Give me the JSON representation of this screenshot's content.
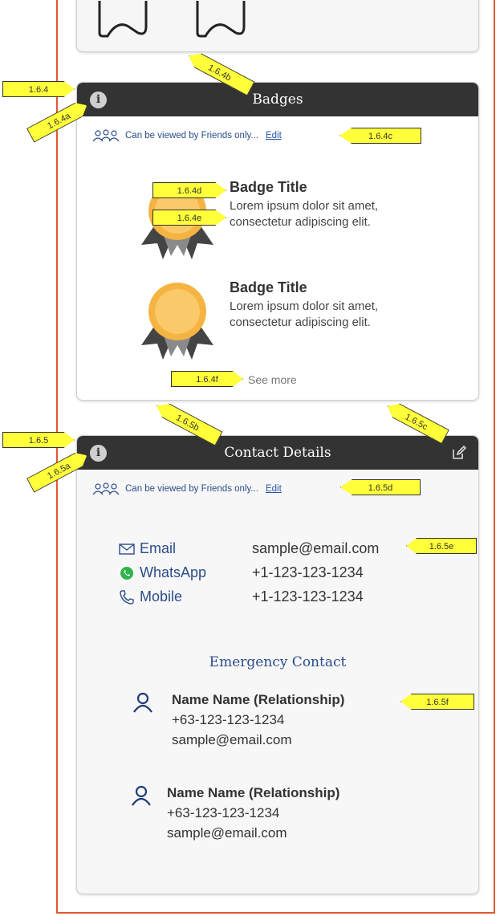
{
  "badges_card": {
    "title": "Badges",
    "privacy_text": "Can be viewed by Friends only...",
    "edit_label": "Edit",
    "items": [
      {
        "title": "Badge Title",
        "desc": "Lorem ipsum dolor sit amet, consectetur adipiscing elit."
      },
      {
        "title": "Badge Title",
        "desc": "Lorem ipsum dolor sit amet, consectetur adipiscing elit."
      }
    ],
    "see_more": "See more"
  },
  "contact_card": {
    "title": "Contact Details",
    "privacy_text": "Can be viewed by Friends only...",
    "edit_label": "Edit",
    "rows": [
      {
        "label": "Email",
        "value": "sample@email.com",
        "icon": "mail-icon"
      },
      {
        "label": "WhatsApp",
        "value": "+1-123-123-1234",
        "icon": "whatsapp-icon"
      },
      {
        "label": "Mobile",
        "value": "+1-123-123-1234",
        "icon": "phone-icon"
      }
    ],
    "emergency": {
      "title": "Emergency Contact",
      "people": [
        {
          "name": "Name Name (Relationship)",
          "phone": "+63-123-123-1234",
          "email": "sample@email.com"
        },
        {
          "name": "Name Name (Relationship)",
          "phone": "+63-123-123-1234",
          "email": "sample@email.com"
        }
      ]
    }
  },
  "annotations": {
    "a_1_6_4": "1.6.4",
    "a_1_6_4a": "1.6.4a",
    "a_1_6_4b": "1.6.4b",
    "a_1_6_4c": "1.6.4c",
    "a_1_6_4d": "1.6.4d",
    "a_1_6_4e": "1.6.4e",
    "a_1_6_4f": "1.6.4f",
    "a_1_6_5": "1.6.5",
    "a_1_6_5a": "1.6.5a",
    "a_1_6_5b": "1.6.5b",
    "a_1_6_5c": "1.6.5c",
    "a_1_6_5d": "1.6.5d",
    "a_1_6_5e": "1.6.5e",
    "a_1_6_5f": "1.6.5f"
  },
  "colors": {
    "header": "#333333",
    "accent_text": "#2b4d8a",
    "callout": "#ffff3a",
    "frame": "#e2572b",
    "medal": "#f5b342"
  }
}
